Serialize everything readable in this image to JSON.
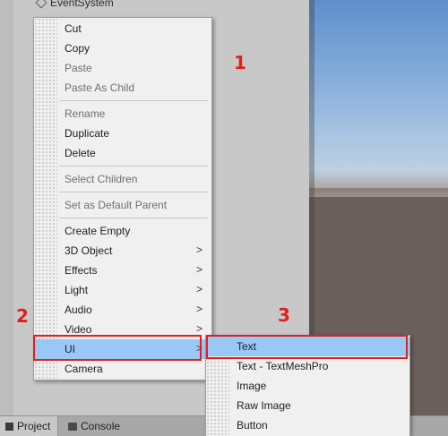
{
  "hierarchy": {
    "partial_item": "EventSystem"
  },
  "bottom_tabs": [
    {
      "label": "Project"
    },
    {
      "label": "Console"
    }
  ],
  "context_menu": {
    "items": [
      {
        "label": "Cut",
        "enabled": true
      },
      {
        "label": "Copy",
        "enabled": true
      },
      {
        "label": "Paste",
        "enabled": false
      },
      {
        "label": "Paste As Child",
        "enabled": false
      },
      {
        "label": "Rename",
        "enabled": false
      },
      {
        "label": "Duplicate",
        "enabled": true
      },
      {
        "label": "Delete",
        "enabled": true
      },
      {
        "label": "Select Children",
        "enabled": false
      },
      {
        "label": "Set as Default Parent",
        "enabled": false
      },
      {
        "label": "Create Empty",
        "enabled": true
      },
      {
        "label": "3D Object",
        "enabled": true,
        "submenu": true
      },
      {
        "label": "Effects",
        "enabled": true,
        "submenu": true
      },
      {
        "label": "Light",
        "enabled": true,
        "submenu": true
      },
      {
        "label": "Audio",
        "enabled": true,
        "submenu": true
      },
      {
        "label": "Video",
        "enabled": true,
        "submenu": true
      },
      {
        "label": "UI",
        "enabled": true,
        "submenu": true,
        "highlighted": true
      },
      {
        "label": "Camera",
        "enabled": true
      }
    ],
    "arrow_glyph": ">"
  },
  "ui_submenu": {
    "items": [
      {
        "label": "Text",
        "highlighted": true
      },
      {
        "label": "Text - TextMeshPro"
      },
      {
        "label": "Image"
      },
      {
        "label": "Raw Image"
      },
      {
        "label": "Button"
      }
    ]
  },
  "annotations": [
    "1",
    "2",
    "3"
  ],
  "colors": {
    "highlight": "#99c8f6",
    "annotation_red": "#e0201c",
    "menu_bg": "#f0f0f0"
  }
}
